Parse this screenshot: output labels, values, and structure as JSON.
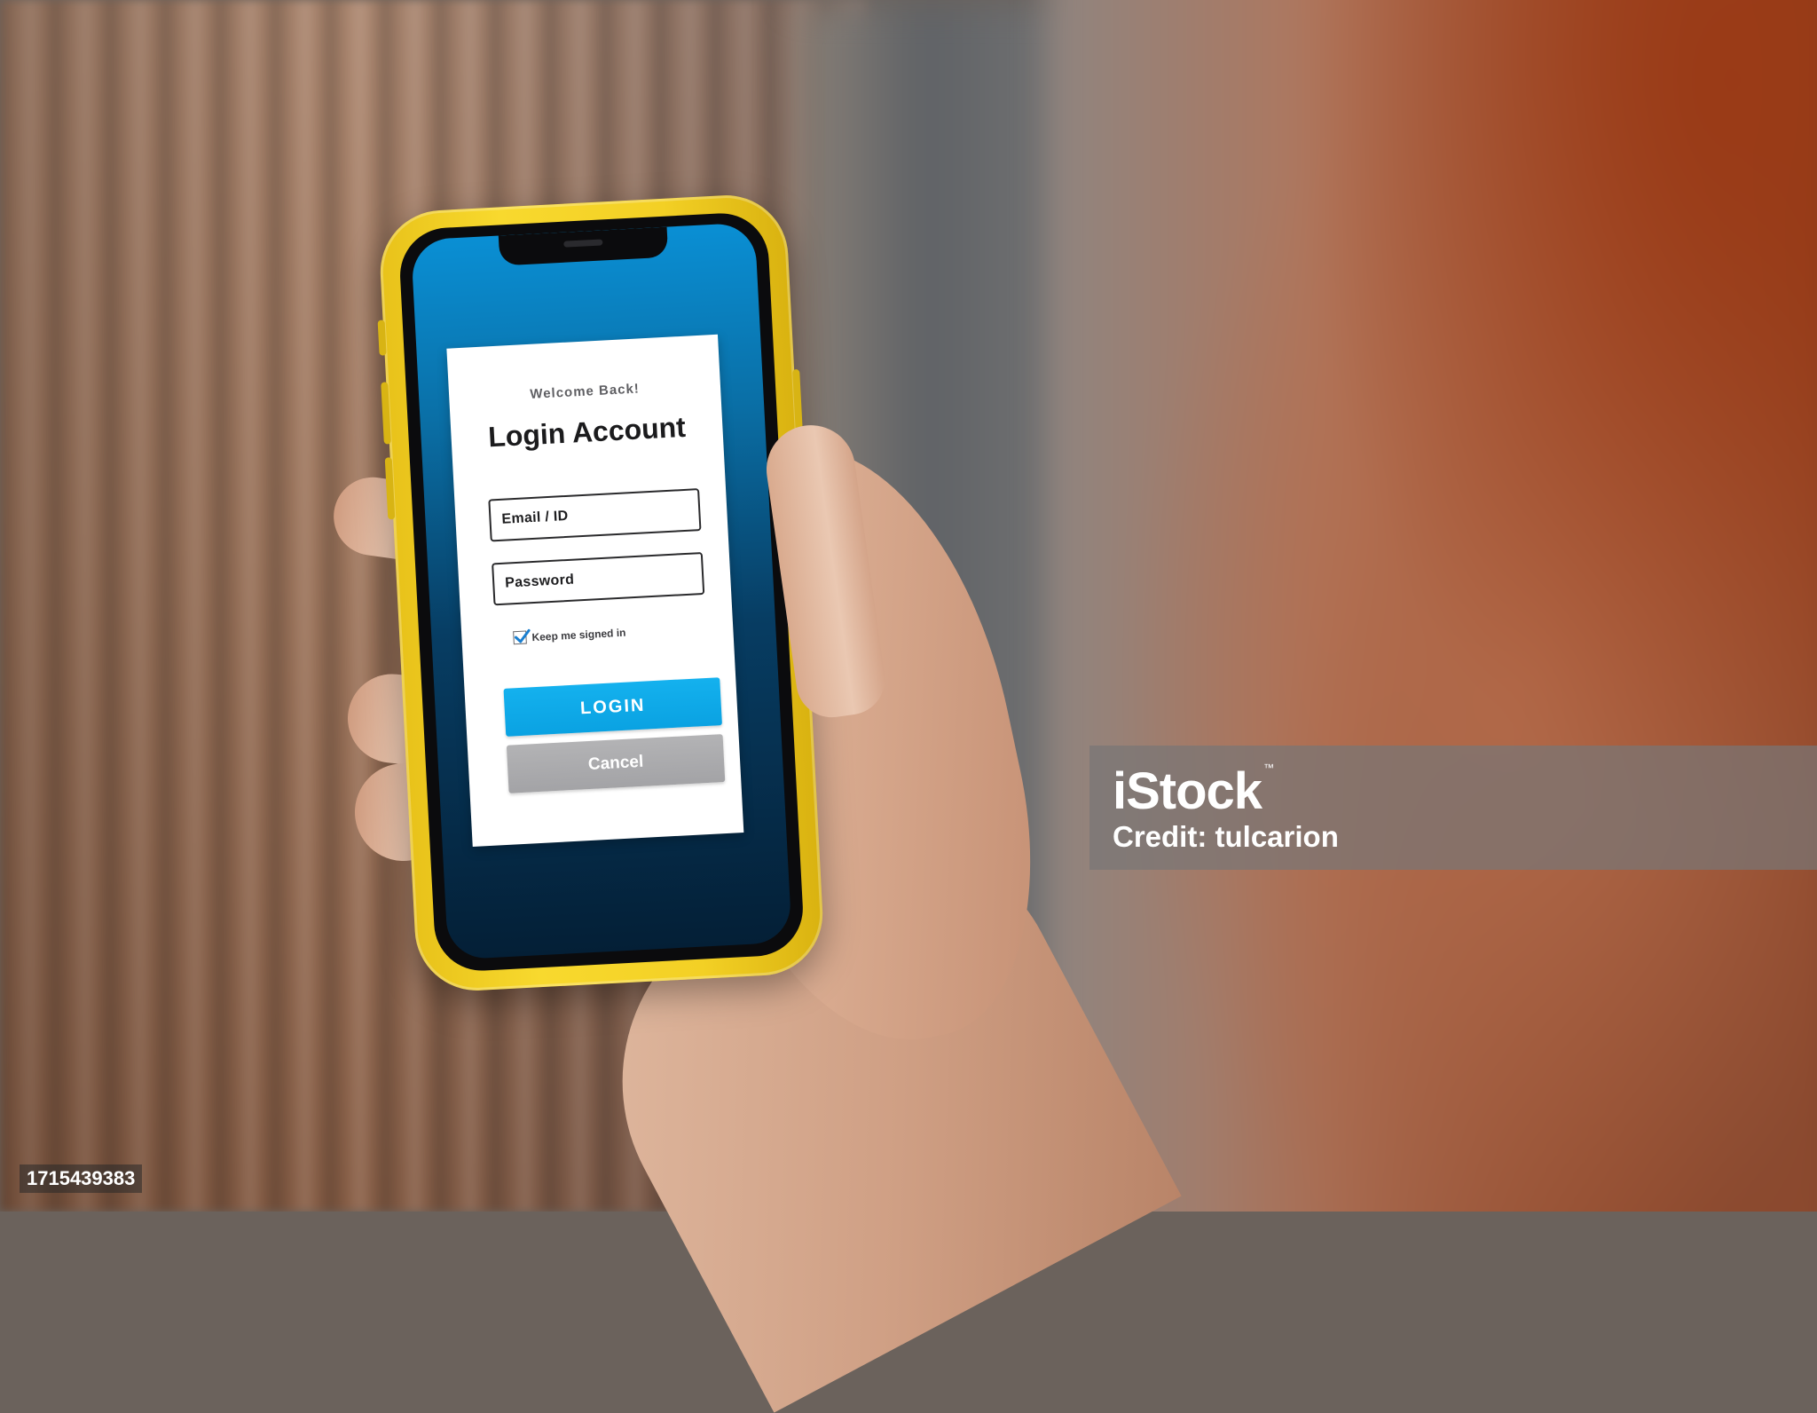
{
  "login_card": {
    "welcome": "Welcome Back!",
    "title": "Login Account",
    "email_placeholder": "Email  /  ID",
    "password_placeholder": "Password",
    "keep_signed_in": "Keep me signed in",
    "keep_signed_in_checked": true,
    "login_button": "LOGIN",
    "cancel_button": "Cancel"
  },
  "colors": {
    "phone_case": "#f5d328",
    "screen_gradient_top": "#0a8fd4",
    "screen_gradient_bottom": "#041f36",
    "login_button": "#0aa2e2",
    "cancel_button": "#a3a3a6"
  },
  "watermark": {
    "brand": "iStock",
    "trademark": "™",
    "credit": "Credit: tulcarion",
    "image_id": "1715439383"
  }
}
